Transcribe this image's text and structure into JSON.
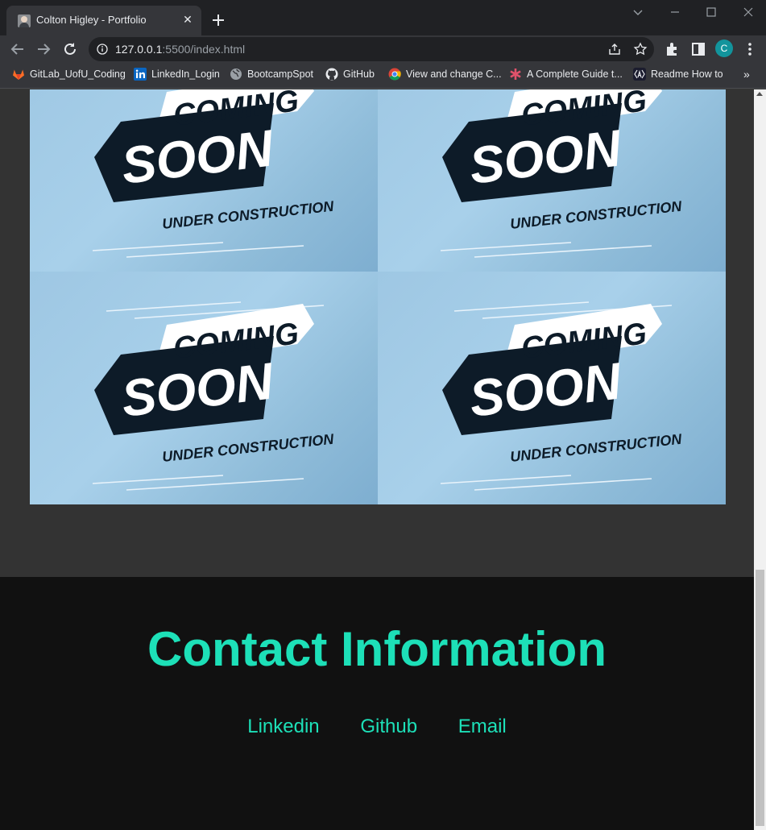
{
  "browser": {
    "tab_title": "Colton Higley - Portfolio",
    "url_host": "127.0.0.1",
    "url_rest": ":5500/index.html",
    "profile_initial": "C",
    "profile_color": "#12949c"
  },
  "bookmarks": [
    {
      "label": "GitLab_UofU_Coding",
      "icon": "gitlab-icon"
    },
    {
      "label": "LinkedIn_Login",
      "icon": "linkedin-icon"
    },
    {
      "label": "BootcampSpot",
      "icon": "globe-icon"
    },
    {
      "label": "GitHub",
      "icon": "github-icon"
    },
    {
      "label": "View and change C...",
      "icon": "chrome-icon"
    },
    {
      "label": "A Complete Guide t...",
      "icon": "asterisk-icon"
    },
    {
      "label": "Readme How to",
      "icon": "readme-icon"
    }
  ],
  "gallery": {
    "items": [
      {
        "line1": "COMING",
        "line2": "SOON",
        "line3": "UNDER CONSTRUCTION"
      },
      {
        "line1": "COMING",
        "line2": "SOON",
        "line3": "UNDER CONSTRUCTION"
      },
      {
        "line1": "COMING",
        "line2": "SOON",
        "line3": "UNDER CONSTRUCTION"
      },
      {
        "line1": "COMING",
        "line2": "SOON",
        "line3": "UNDER CONSTRUCTION"
      }
    ]
  },
  "contact": {
    "title": "Contact Information",
    "links": [
      {
        "label": "Linkedin"
      },
      {
        "label": "Github"
      },
      {
        "label": "Email"
      }
    ],
    "accent_color": "#1de0b8"
  }
}
